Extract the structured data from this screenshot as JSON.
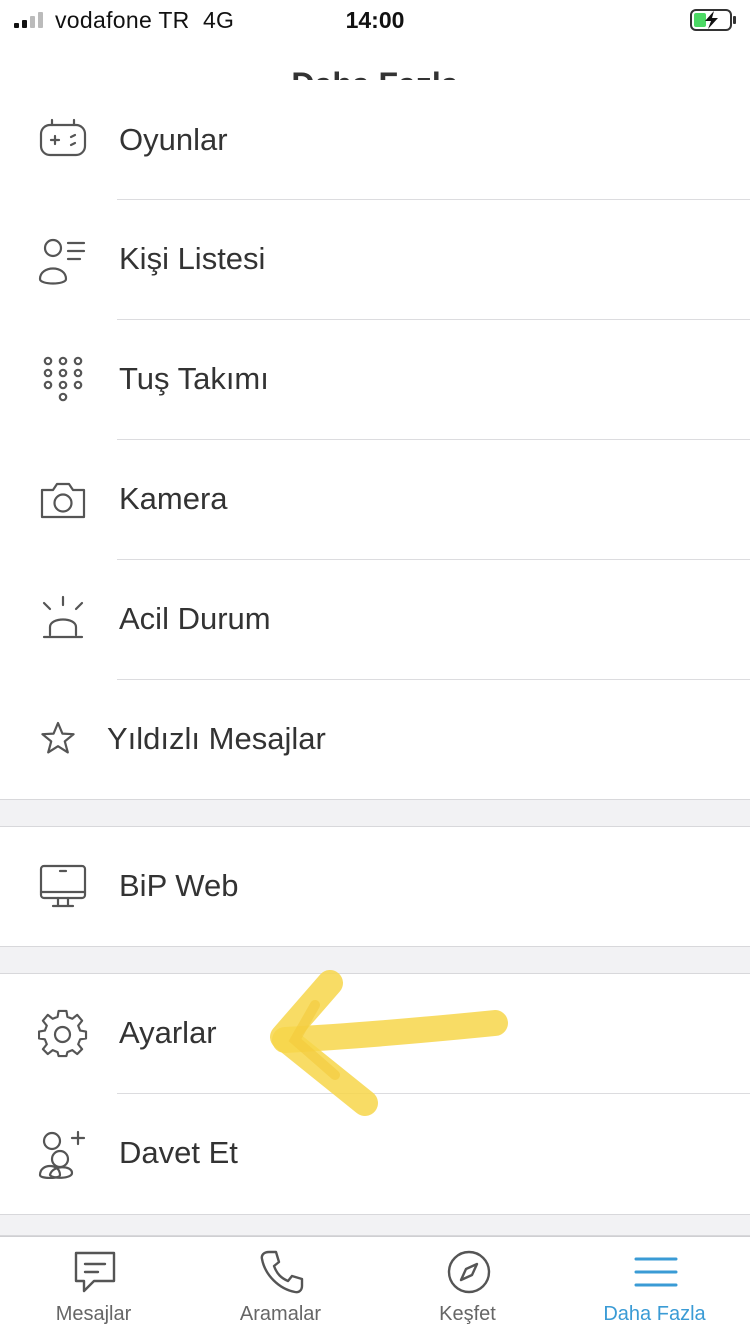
{
  "status_bar": {
    "carrier": "vodafone TR",
    "network": "4G",
    "time": "14:00"
  },
  "nav": {
    "title": "Daha Fazla"
  },
  "menu": {
    "items": [
      {
        "id": "oyunlar",
        "label": "Oyunlar",
        "icon": "gamepad-icon"
      },
      {
        "id": "kisi-listesi",
        "label": "Kişi Listesi",
        "icon": "contact-list-icon"
      },
      {
        "id": "tus-takimi",
        "label": "Tuş Takımı",
        "icon": "keypad-icon"
      },
      {
        "id": "kamera",
        "label": "Kamera",
        "icon": "camera-icon"
      },
      {
        "id": "acil-durum",
        "label": "Acil Durum",
        "icon": "siren-icon"
      },
      {
        "id": "yildizli-mesajlar",
        "label": "Yıldızlı Mesajlar",
        "icon": "star-icon"
      },
      {
        "id": "bip-web",
        "label": "BiP Web",
        "icon": "monitor-icon"
      },
      {
        "id": "ayarlar",
        "label": "Ayarlar",
        "icon": "gear-icon"
      },
      {
        "id": "davet-et",
        "label": "Davet Et",
        "icon": "invite-user-icon"
      }
    ]
  },
  "tabs": [
    {
      "label": "Mesajlar",
      "icon": "message-icon",
      "active": false
    },
    {
      "label": "Aramalar",
      "icon": "phone-icon",
      "active": false
    },
    {
      "label": "Keşfet",
      "icon": "compass-icon",
      "active": false
    },
    {
      "label": "Daha Fazla",
      "icon": "menu-icon",
      "active": true
    }
  ],
  "colors": {
    "accent": "#3a9bd5",
    "text": "#333333",
    "icon": "#555555",
    "section_bg": "#f2f2f4",
    "battery_green": "#4cd964",
    "highlight": "#f7d64a"
  }
}
